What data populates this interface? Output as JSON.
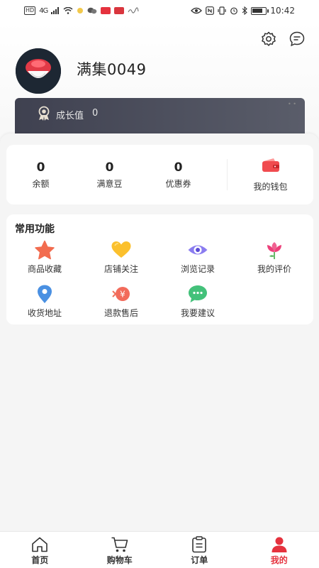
{
  "status_bar": {
    "network_badge": "HD",
    "signal": "4G",
    "time": "10:42",
    "battery_level": 0.85
  },
  "profile": {
    "username": "满集0049",
    "growth_label": "成长值",
    "growth_value": "0"
  },
  "wallet": {
    "stats": [
      {
        "value": "0",
        "label": "余额"
      },
      {
        "value": "0",
        "label": "满意豆"
      },
      {
        "value": "0",
        "label": "优惠券"
      }
    ],
    "my_wallet_label": "我的钱包"
  },
  "features": {
    "title": "常用功能",
    "items": [
      {
        "label": "商品收藏",
        "icon": "star-icon"
      },
      {
        "label": "店铺关注",
        "icon": "heart-icon"
      },
      {
        "label": "浏览记录",
        "icon": "eye-icon"
      },
      {
        "label": "我的评价",
        "icon": "flower-icon"
      },
      {
        "label": "收货地址",
        "icon": "location-pin-icon"
      },
      {
        "label": "退款售后",
        "icon": "refund-coin-icon"
      },
      {
        "label": "我要建议",
        "icon": "chat-bubble-icon"
      }
    ]
  },
  "tabs": [
    {
      "label": "首页",
      "icon": "home-icon",
      "active": false
    },
    {
      "label": "购物车",
      "icon": "cart-icon",
      "active": false
    },
    {
      "label": "订单",
      "icon": "clipboard-icon",
      "active": false
    },
    {
      "label": "我的",
      "icon": "person-icon",
      "active": true
    }
  ],
  "colors": {
    "accent": "#e5323e",
    "growth_card": "#4a4c5a"
  }
}
